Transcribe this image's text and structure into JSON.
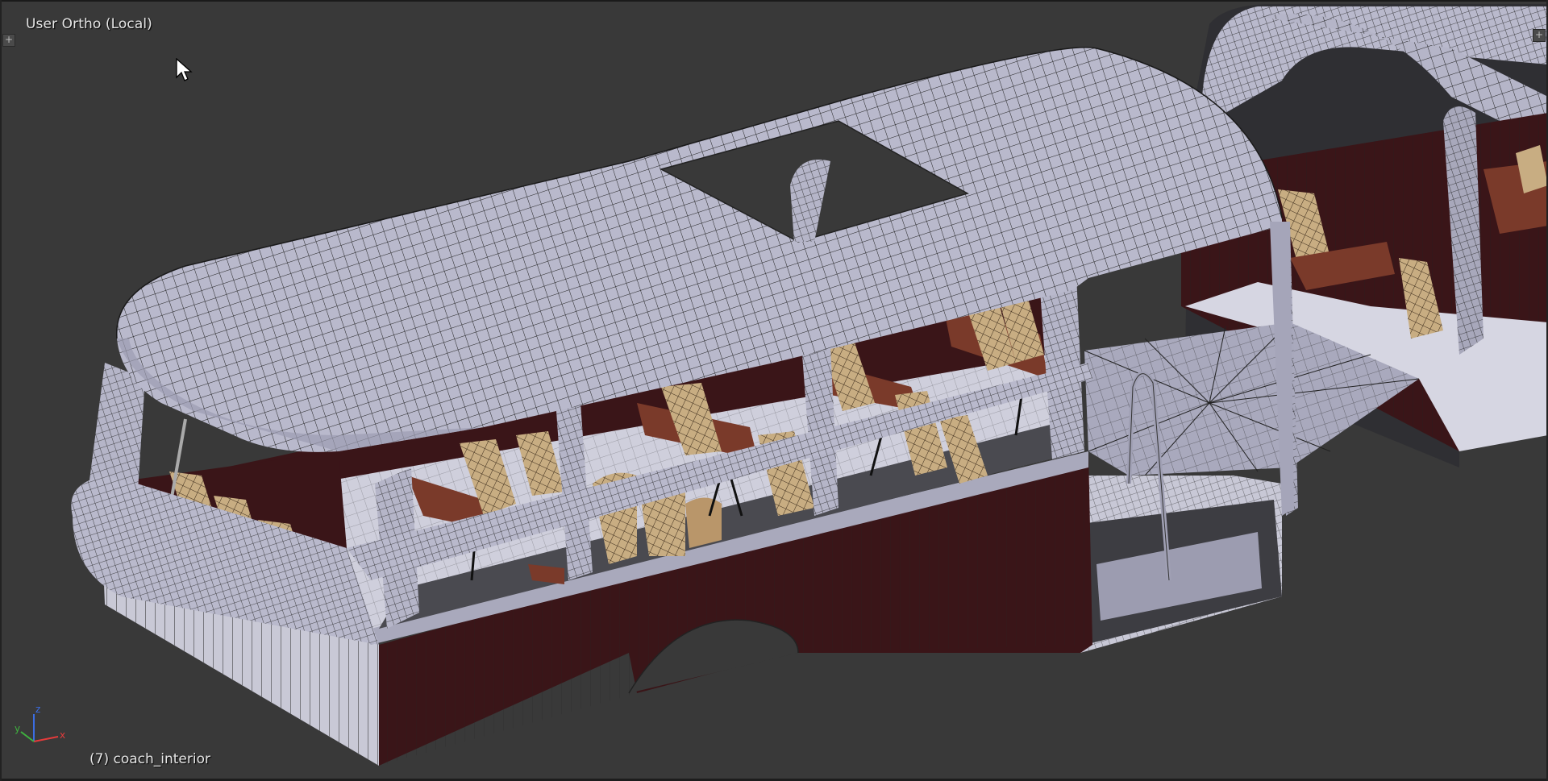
{
  "viewport": {
    "view_name": "User Ortho (Local)",
    "object_info": "(7) coach_interior",
    "background_color": "#393939",
    "corner_widgets": [
      "plus-icon",
      "plus-icon"
    ]
  },
  "axis_gizmo": {
    "x_label": "x",
    "y_label": "y",
    "z_label": "z",
    "x_color": "#e33b3b",
    "y_color": "#3fb13f",
    "z_color": "#3b6de3"
  },
  "model": {
    "name": "coach_interior",
    "body_color": "#b9b9cc",
    "panel_color": "#3a1518",
    "seat_color": "#c8ad82",
    "table_color": "#7a3a2a",
    "wire_color": "#1a1a1a"
  }
}
